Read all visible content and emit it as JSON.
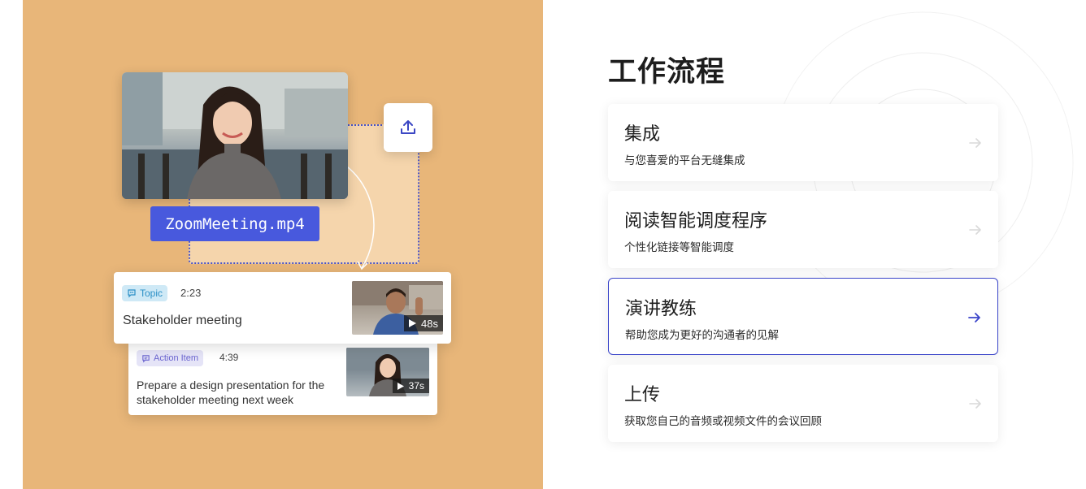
{
  "illustration": {
    "filename": "ZoomMeeting.mp4",
    "cards": [
      {
        "tag": "Topic",
        "time": "2:23",
        "title": "Stakeholder meeting",
        "duration": "48s"
      },
      {
        "tag": "Action Item",
        "time": "4:39",
        "title": "Prepare a design presentation for the stakeholder meeting next week",
        "duration": "37s"
      }
    ]
  },
  "workflow": {
    "title": "工作流程",
    "items": [
      {
        "title": "集成",
        "description": "与您喜爱的平台无缝集成",
        "active": false
      },
      {
        "title": "阅读智能调度程序",
        "description": "个性化链接等智能调度",
        "active": false
      },
      {
        "title": "演讲教练",
        "description": "帮助您成为更好的沟通者的见解",
        "active": true
      },
      {
        "title": "上传",
        "description": "获取您自己的音频或视频文件的会议回顾",
        "active": false
      }
    ]
  },
  "colors": {
    "panel_bg": "#e8b679",
    "accent": "#4859dd",
    "active_border": "#3a44c9",
    "inactive_arrow": "#d9d9d9"
  }
}
